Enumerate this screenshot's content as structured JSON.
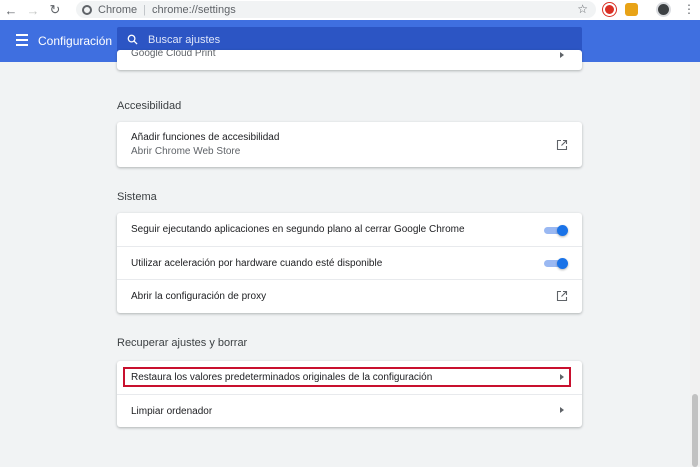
{
  "browser": {
    "site_label": "Chrome",
    "url": "chrome://settings",
    "icons": [
      "back-icon",
      "forward-icon",
      "reload-icon",
      "star-icon",
      "extension-icons",
      "avatar",
      "menu-icon"
    ]
  },
  "header": {
    "title": "Configuración",
    "search_placeholder": "Buscar ajustes"
  },
  "cut_row": {
    "label": "Google Cloud Print"
  },
  "accessibility": {
    "title": "Accesibilidad",
    "row_label": "Añadir funciones de accesibilidad",
    "row_sub": "Abrir Chrome Web Store"
  },
  "system": {
    "title": "Sistema",
    "rows": [
      {
        "label": "Seguir ejecutando aplicaciones en segundo plano al cerrar Google Chrome",
        "toggle_on": true
      },
      {
        "label": "Utilizar aceleración por hardware cuando esté disponible",
        "toggle_on": true
      },
      {
        "label": "Abrir la configuración de proxy"
      }
    ]
  },
  "reset": {
    "title": "Recuperar ajustes y borrar",
    "rows": [
      {
        "label": "Restaura los valores predeterminados originales de la configuración"
      },
      {
        "label": "Limpiar ordenador"
      }
    ]
  },
  "colors": {
    "header": "#3f6fe0",
    "accent": "#1a73e8",
    "highlight": "#c8102e"
  }
}
